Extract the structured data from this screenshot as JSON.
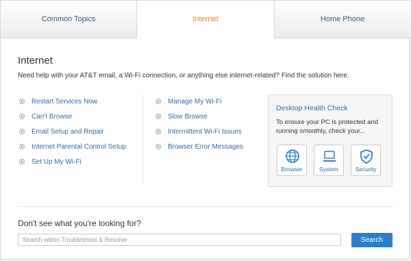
{
  "tabs": [
    {
      "label": "Common Topics",
      "active": false
    },
    {
      "label": "Internet",
      "active": true
    },
    {
      "label": "Home Phone",
      "active": false
    }
  ],
  "section": {
    "title": "Internet",
    "intro": "Need help with your AT&T email, a Wi-Fi connection, or anything else internet-related? Find the solution here."
  },
  "links_left": [
    "Restart Services Now",
    "Can't Browse",
    "Email Setup and Repair",
    "Internet Parental Control Setup",
    "Set Up My Wi-Fi"
  ],
  "links_right": [
    "Manage My Wi-Fi",
    "Slow Browse",
    "Intermittent Wi-Fi Issues",
    "Browser Error Messages"
  ],
  "health_check": {
    "title": "Desktop Health Check",
    "text": "To ensure your PC is protected and running smoothly, check your...",
    "buttons": [
      {
        "label": "Browser",
        "icon": "globe-icon"
      },
      {
        "label": "System",
        "icon": "laptop-icon"
      },
      {
        "label": "Security",
        "icon": "shield-check-icon"
      }
    ]
  },
  "search": {
    "heading": "Don't see what you're looking for?",
    "placeholder": "Search within Troubleshoot & Resolve",
    "value": "",
    "button_label": "Search"
  },
  "colors": {
    "accent": "#ee7d1f",
    "link": "#2f6ba4",
    "button": "#2b7fca"
  }
}
